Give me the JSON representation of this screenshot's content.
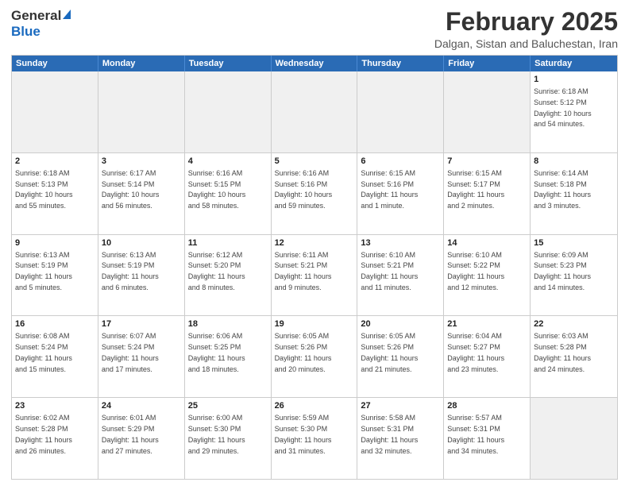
{
  "header": {
    "logo_general": "General",
    "logo_blue": "Blue",
    "month_title": "February 2025",
    "location": "Dalgan, Sistan and Baluchestan, Iran"
  },
  "weekdays": [
    "Sunday",
    "Monday",
    "Tuesday",
    "Wednesday",
    "Thursday",
    "Friday",
    "Saturday"
  ],
  "rows": [
    [
      {
        "day": "",
        "info": ""
      },
      {
        "day": "",
        "info": ""
      },
      {
        "day": "",
        "info": ""
      },
      {
        "day": "",
        "info": ""
      },
      {
        "day": "",
        "info": ""
      },
      {
        "day": "",
        "info": ""
      },
      {
        "day": "1",
        "info": "Sunrise: 6:18 AM\nSunset: 5:12 PM\nDaylight: 10 hours\nand 54 minutes."
      }
    ],
    [
      {
        "day": "2",
        "info": "Sunrise: 6:18 AM\nSunset: 5:13 PM\nDaylight: 10 hours\nand 55 minutes."
      },
      {
        "day": "3",
        "info": "Sunrise: 6:17 AM\nSunset: 5:14 PM\nDaylight: 10 hours\nand 56 minutes."
      },
      {
        "day": "4",
        "info": "Sunrise: 6:16 AM\nSunset: 5:15 PM\nDaylight: 10 hours\nand 58 minutes."
      },
      {
        "day": "5",
        "info": "Sunrise: 6:16 AM\nSunset: 5:16 PM\nDaylight: 10 hours\nand 59 minutes."
      },
      {
        "day": "6",
        "info": "Sunrise: 6:15 AM\nSunset: 5:16 PM\nDaylight: 11 hours\nand 1 minute."
      },
      {
        "day": "7",
        "info": "Sunrise: 6:15 AM\nSunset: 5:17 PM\nDaylight: 11 hours\nand 2 minutes."
      },
      {
        "day": "8",
        "info": "Sunrise: 6:14 AM\nSunset: 5:18 PM\nDaylight: 11 hours\nand 3 minutes."
      }
    ],
    [
      {
        "day": "9",
        "info": "Sunrise: 6:13 AM\nSunset: 5:19 PM\nDaylight: 11 hours\nand 5 minutes."
      },
      {
        "day": "10",
        "info": "Sunrise: 6:13 AM\nSunset: 5:19 PM\nDaylight: 11 hours\nand 6 minutes."
      },
      {
        "day": "11",
        "info": "Sunrise: 6:12 AM\nSunset: 5:20 PM\nDaylight: 11 hours\nand 8 minutes."
      },
      {
        "day": "12",
        "info": "Sunrise: 6:11 AM\nSunset: 5:21 PM\nDaylight: 11 hours\nand 9 minutes."
      },
      {
        "day": "13",
        "info": "Sunrise: 6:10 AM\nSunset: 5:21 PM\nDaylight: 11 hours\nand 11 minutes."
      },
      {
        "day": "14",
        "info": "Sunrise: 6:10 AM\nSunset: 5:22 PM\nDaylight: 11 hours\nand 12 minutes."
      },
      {
        "day": "15",
        "info": "Sunrise: 6:09 AM\nSunset: 5:23 PM\nDaylight: 11 hours\nand 14 minutes."
      }
    ],
    [
      {
        "day": "16",
        "info": "Sunrise: 6:08 AM\nSunset: 5:24 PM\nDaylight: 11 hours\nand 15 minutes."
      },
      {
        "day": "17",
        "info": "Sunrise: 6:07 AM\nSunset: 5:24 PM\nDaylight: 11 hours\nand 17 minutes."
      },
      {
        "day": "18",
        "info": "Sunrise: 6:06 AM\nSunset: 5:25 PM\nDaylight: 11 hours\nand 18 minutes."
      },
      {
        "day": "19",
        "info": "Sunrise: 6:05 AM\nSunset: 5:26 PM\nDaylight: 11 hours\nand 20 minutes."
      },
      {
        "day": "20",
        "info": "Sunrise: 6:05 AM\nSunset: 5:26 PM\nDaylight: 11 hours\nand 21 minutes."
      },
      {
        "day": "21",
        "info": "Sunrise: 6:04 AM\nSunset: 5:27 PM\nDaylight: 11 hours\nand 23 minutes."
      },
      {
        "day": "22",
        "info": "Sunrise: 6:03 AM\nSunset: 5:28 PM\nDaylight: 11 hours\nand 24 minutes."
      }
    ],
    [
      {
        "day": "23",
        "info": "Sunrise: 6:02 AM\nSunset: 5:28 PM\nDaylight: 11 hours\nand 26 minutes."
      },
      {
        "day": "24",
        "info": "Sunrise: 6:01 AM\nSunset: 5:29 PM\nDaylight: 11 hours\nand 27 minutes."
      },
      {
        "day": "25",
        "info": "Sunrise: 6:00 AM\nSunset: 5:30 PM\nDaylight: 11 hours\nand 29 minutes."
      },
      {
        "day": "26",
        "info": "Sunrise: 5:59 AM\nSunset: 5:30 PM\nDaylight: 11 hours\nand 31 minutes."
      },
      {
        "day": "27",
        "info": "Sunrise: 5:58 AM\nSunset: 5:31 PM\nDaylight: 11 hours\nand 32 minutes."
      },
      {
        "day": "28",
        "info": "Sunrise: 5:57 AM\nSunset: 5:31 PM\nDaylight: 11 hours\nand 34 minutes."
      },
      {
        "day": "",
        "info": ""
      }
    ]
  ]
}
